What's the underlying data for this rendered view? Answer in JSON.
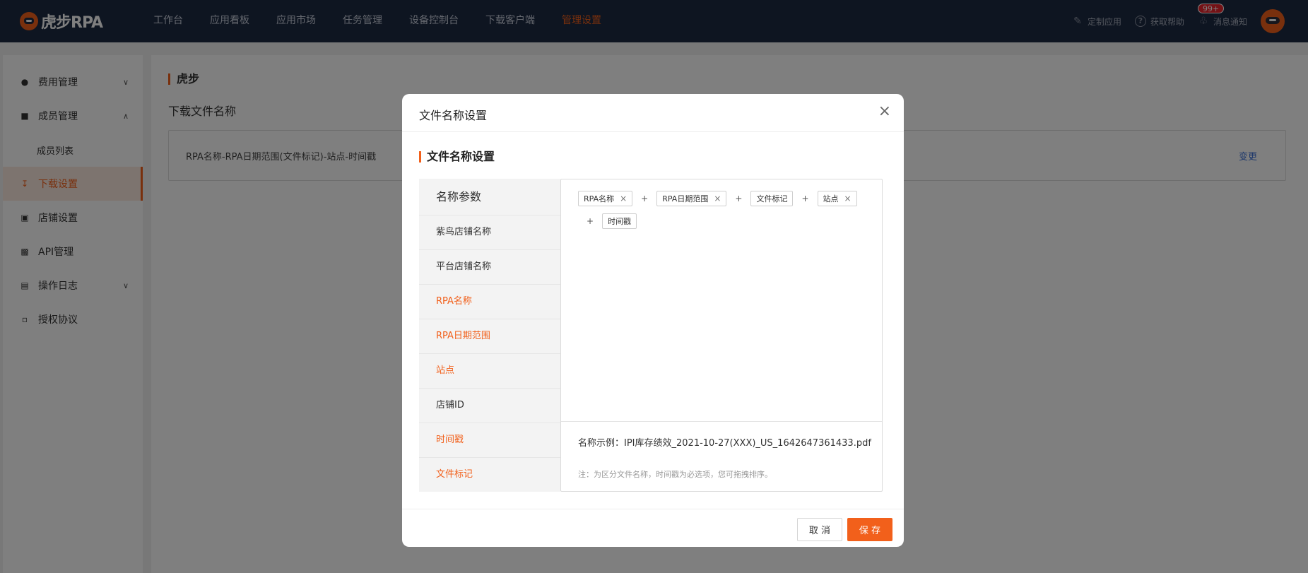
{
  "brand": {
    "logo_text": "虎步RPA"
  },
  "nav": {
    "items": [
      "工作台",
      "应用看板",
      "应用市场",
      "任务管理",
      "设备控制台",
      "下载客户端",
      "管理设置"
    ],
    "active_index": 6
  },
  "topright": {
    "custom_app": "定制应用",
    "help": "获取帮助",
    "notifications": "消息通知",
    "badge": "99+"
  },
  "sidebar": {
    "items": [
      {
        "label": "费用管理",
        "icon": "money-bag-icon",
        "chevron": "down"
      },
      {
        "label": "成员管理",
        "icon": "briefcase-icon",
        "chevron": "up"
      },
      {
        "label": "成员列表",
        "sub": true
      },
      {
        "label": "下载设置",
        "icon": "download-icon",
        "active": true
      },
      {
        "label": "店铺设置",
        "icon": "store-icon"
      },
      {
        "label": "API管理",
        "icon": "api-icon"
      },
      {
        "label": "操作日志",
        "icon": "log-icon",
        "chevron": "down"
      },
      {
        "label": "授权协议",
        "icon": "document-icon"
      }
    ]
  },
  "main": {
    "title": "虎步",
    "subtitle": "下载文件名称",
    "format": "RPA名称-RPA日期范围(文件标记)-站点-时间戳",
    "change_link": "变更"
  },
  "modal": {
    "title": "文件名称设置",
    "close": "×",
    "section_title": "文件名称设置",
    "params_header": "名称参数",
    "params": [
      {
        "label": "紫鸟店铺名称",
        "selected": false
      },
      {
        "label": "平台店铺名称",
        "selected": false
      },
      {
        "label": "RPA名称",
        "selected": true
      },
      {
        "label": "RPA日期范围",
        "selected": true
      },
      {
        "label": "站点",
        "selected": true
      },
      {
        "label": "店铺ID",
        "selected": false
      },
      {
        "label": "时间戳",
        "selected": true
      },
      {
        "label": "文件标记",
        "selected": true
      }
    ],
    "tags": [
      {
        "label": "RPA名称",
        "removable": true
      },
      {
        "label": "RPA日期范围",
        "removable": true
      },
      {
        "label": "文件标记",
        "removable": false
      },
      {
        "label": "站点",
        "removable": true
      },
      {
        "label": "时间戳",
        "removable": false
      }
    ],
    "plus": "+",
    "remove": "×",
    "example": "名称示例：IPI库存绩效_2021-10-27(XXX)_US_1642647361433.pdf",
    "note": "注：为区分文件名称，时间戳为必选项，您可拖拽排序。",
    "cancel": "取 消",
    "save": "保 存"
  },
  "colors": {
    "accent": "#f2601b",
    "nav_bg": "#1d2a43",
    "link": "#3b6fd6"
  }
}
